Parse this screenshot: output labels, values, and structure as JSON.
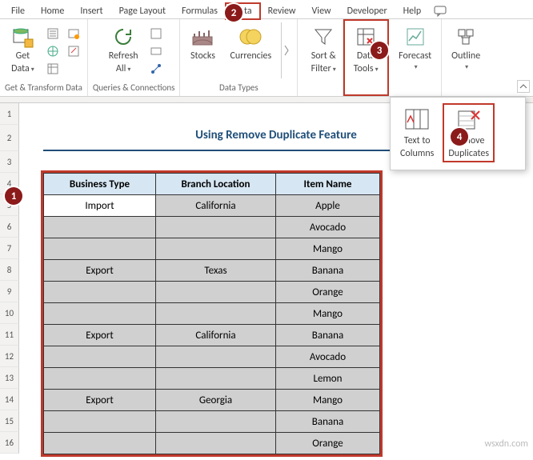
{
  "tabs": {
    "file": "File",
    "home": "Home",
    "insert": "Insert",
    "pageLayout": "Page Layout",
    "formulas": "Formulas",
    "data": "Data",
    "review": "Review",
    "view": "View",
    "developer": "Developer",
    "help": "Help"
  },
  "ribbon": {
    "getData": {
      "line1": "Get",
      "line2": "Data",
      "groupLabel": "Get & Transform Data"
    },
    "refreshAll": {
      "line1": "Refresh",
      "line2": "All",
      "groupLabel": "Queries & Connections"
    },
    "stocks": "Stocks",
    "currencies": "Currencies",
    "dataTypesGroup": "Data Types",
    "sortFilter": {
      "line1": "Sort &",
      "line2": "Filter"
    },
    "dataTools": {
      "line1": "Data",
      "line2": "Tools"
    },
    "forecast": "Forecast",
    "outline": "Outline"
  },
  "popup": {
    "textToColumns": {
      "line1": "Text to",
      "line2": "Columns"
    },
    "removeDuplicates": {
      "line1": "Remove",
      "line2": "Duplicates"
    }
  },
  "sheetTitle": "Using Remove Duplicate Feature",
  "badges": {
    "b1": "1",
    "b2": "2",
    "b3": "3",
    "b4": "4"
  },
  "rowHeaders": [
    "1",
    "2",
    "3",
    "4",
    "5",
    "6",
    "7",
    "8",
    "9",
    "10",
    "11",
    "12",
    "13",
    "14",
    "15",
    "16"
  ],
  "table": {
    "headers": {
      "col1": "Business Type",
      "col2": "Branch Location",
      "col3": "Item Name"
    },
    "rows": [
      {
        "c1": "Import",
        "c2": "California",
        "c3": "Apple",
        "active": true
      },
      {
        "c1": "",
        "c2": "",
        "c3": "Avocado"
      },
      {
        "c1": "",
        "c2": "",
        "c3": "Mango"
      },
      {
        "c1": "Export",
        "c2": "Texas",
        "c3": "Banana"
      },
      {
        "c1": "",
        "c2": "",
        "c3": "Orange"
      },
      {
        "c1": "",
        "c2": "",
        "c3": "Mango"
      },
      {
        "c1": "Export",
        "c2": "California",
        "c3": "Banana"
      },
      {
        "c1": "",
        "c2": "",
        "c3": "Avocado"
      },
      {
        "c1": "",
        "c2": "",
        "c3": "Lemon"
      },
      {
        "c1": "Export",
        "c2": "Georgia",
        "c3": "Mango"
      },
      {
        "c1": "",
        "c2": "",
        "c3": "Banana"
      },
      {
        "c1": "",
        "c2": "",
        "c3": "Orange"
      }
    ]
  },
  "watermark": "wsxdn.com"
}
